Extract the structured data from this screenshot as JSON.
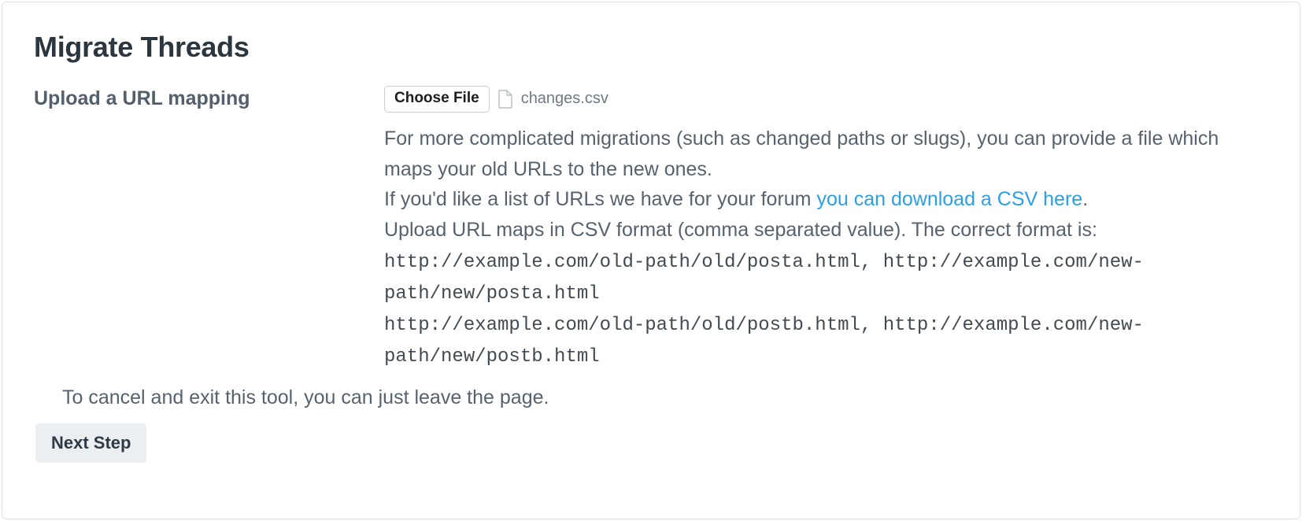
{
  "title": "Migrate Threads",
  "upload": {
    "label": "Upload a URL mapping",
    "choose_file_label": "Choose File",
    "selected_file_name": "changes.csv",
    "description_line1": "For more complicated migrations (such as changed paths or slugs), you can provide a file which maps your old URLs to the new ones.",
    "description_line2_prefix": "If you'd like a list of URLs we have for your forum ",
    "download_link_text": "you can download a CSV here",
    "description_line3": "Upload URL maps in CSV format (comma separated value). The correct format is:",
    "example_line1": "http://example.com/old-path/old/posta.html, http://example.com/new-path/new/posta.html",
    "example_line2": "http://example.com/old-path/old/postb.html, http://example.com/new-path/new/postb.html"
  },
  "hint": "To cancel and exit this tool, you can just leave the page.",
  "next_step_label": "Next Step"
}
